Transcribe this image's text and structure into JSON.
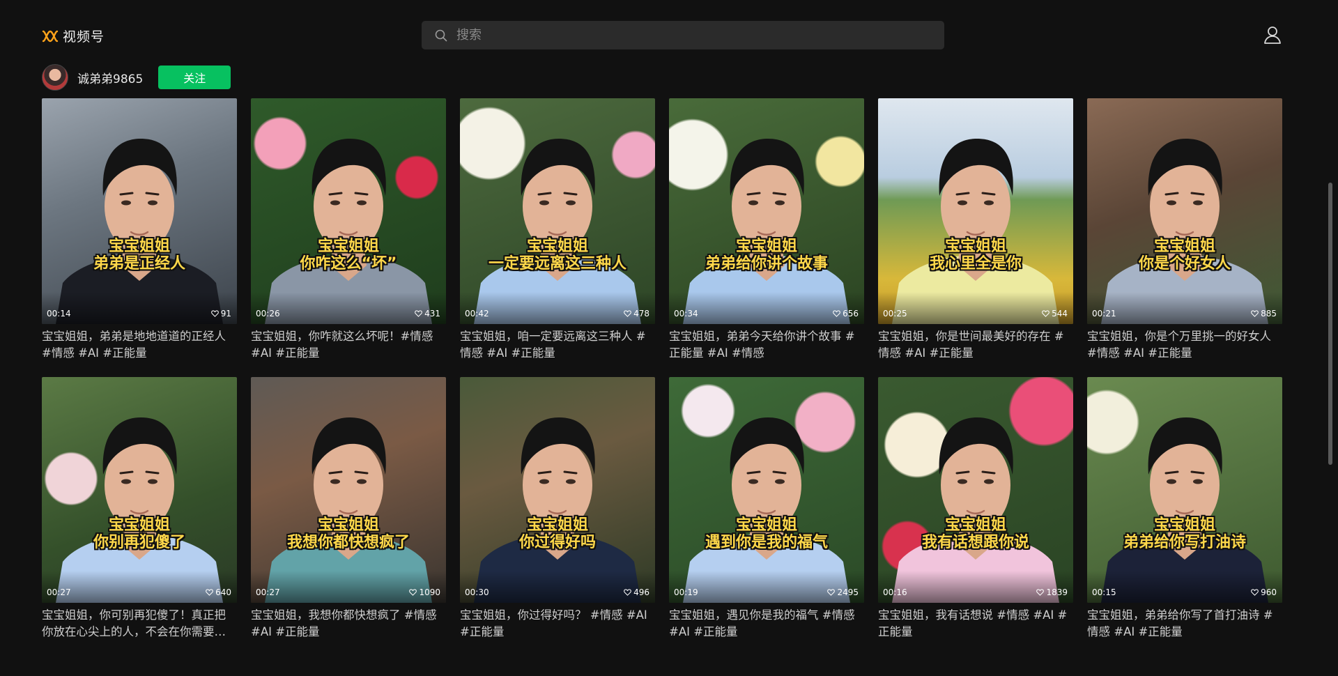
{
  "header": {
    "logo_text": "视频号",
    "search_placeholder": "搜索",
    "accent": "#ffa31a"
  },
  "author": {
    "name": "诚弟弟9865",
    "follow_label": "关注",
    "follow_color": "#07c160"
  },
  "videos": [
    {
      "line1": "宝宝姐姐",
      "line2": "弟弟是正经人",
      "duration": "00:14",
      "likes": "91",
      "desc": "宝宝姐姐，弟弟是地地道道的正经人 #情感 #AI #正能量",
      "bg": "linear-gradient(160deg,#9aa3ad 0%,#6c7680 40%,#3c434b 100%)",
      "shirt": "#1b1d24"
    },
    {
      "line1": "宝宝姐姐",
      "line2": "你咋这么“坏”",
      "duration": "00:26",
      "likes": "431",
      "desc": "宝宝姐姐，你咋就这么坏呢！#情感 #AI #正能量",
      "bg": "radial-gradient(circle at 15% 20%,#f3a0b9 0 10%,transparent 11%),radial-gradient(circle at 85% 35%,#d92a4a 0 9%,transparent 10%),linear-gradient(160deg,#2f5a2a 0%,#1f3d1d 100%)",
      "shirt": "#8a96a6"
    },
    {
      "line1": "宝宝姐姐",
      "line2": "一定要远离这三种人",
      "duration": "00:42",
      "likes": "478",
      "desc": "宝宝姐姐，咱一定要远离这三种人 #情感 #AI #正能量",
      "bg": "radial-gradient(circle at 15% 20%,#f4f2e6 0 14%,transparent 15%),radial-gradient(circle at 90% 25%,#f0a9c4 0 9%,transparent 10%),linear-gradient(160deg,#4d6a3e 0%,#2d4526 100%)",
      "shirt": "#a9c8ec"
    },
    {
      "line1": "宝宝姐姐",
      "line2": "弟弟给你讲个故事",
      "duration": "00:34",
      "likes": "656",
      "desc": "宝宝姐姐，弟弟今天给你讲个故事 #正能量 #AI #情感",
      "bg": "radial-gradient(circle at 12% 25%,#f4f4ea 0 14%,transparent 15%),radial-gradient(circle at 88% 28%,#f2e6a0 0 10%,transparent 11%),linear-gradient(160deg,#496b3a 0%,#2b4422 100%)",
      "shirt": "#a9c8ec"
    },
    {
      "line1": "宝宝姐姐",
      "line2": "我心里全是你",
      "duration": "00:25",
      "likes": "544",
      "desc": "宝宝姐姐，你是世间最美好的存在 #情感 #AI #正能量",
      "bg": "linear-gradient(180deg,#dfe7ef 0%,#b9cde0 35%,#6f9a55 45%,#d8b83a 80%,#c79a2a 100%)",
      "shirt": "#eceaa0"
    },
    {
      "line1": "宝宝姐姐",
      "line2": "你是个好女人",
      "duration": "00:21",
      "likes": "885",
      "desc": "宝宝姐姐，你是个万里挑一的好女人 #情感 #AI #正能量",
      "bg": "linear-gradient(160deg,#8a6a55 0%,#5a4536 45%,#3f5a35 100%)",
      "shirt": "#a6b3c6"
    },
    {
      "line1": "宝宝姐姐",
      "line2": "你别再犯傻了",
      "duration": "00:27",
      "likes": "640",
      "desc": "宝宝姐姐，你可别再犯傻了！真正把你放在心尖上的人，不会在你需要的时候消失",
      "bg": "radial-gradient(circle at 15% 45%,#f0d4d8 0 12%,transparent 13%),linear-gradient(160deg,#5b7a45 0%,#34502a 60%,#2a3a26 100%)",
      "shirt": "#b5cff0"
    },
    {
      "line1": "宝宝姐姐",
      "line2": "我想你都快想疯了",
      "duration": "00:27",
      "likes": "1090",
      "desc": "宝宝姐姐，我想你都快想疯了 #情感 #AI #正能量",
      "bg": "linear-gradient(160deg,#5f5a55 0%,#7a5a45 40%,#3a3530 100%)",
      "shirt": "#62a3a8"
    },
    {
      "line1": "宝宝姐姐",
      "line2": "你过得好吗",
      "duration": "00:30",
      "likes": "496",
      "desc": "宝宝姐姐，你过得好吗？ #情感 #AI #正能量",
      "bg": "linear-gradient(160deg,#4a5a3a 0%,#6a5a40 40%,#2e3a26 100%)",
      "shirt": "#1e2a44"
    },
    {
      "line1": "宝宝姐姐",
      "line2": "遇到你是我的福气",
      "duration": "00:19",
      "likes": "2495",
      "desc": "宝宝姐姐，遇见你是我的福气 #情感 #AI #正能量",
      "bg": "radial-gradient(circle at 80% 20%,#f2b0c6 0 12%,transparent 13%),radial-gradient(circle at 20% 15%,#f4e8ee 0 10%,transparent 11%),linear-gradient(160deg,#3e6a38 0%,#2b4a27 100%)",
      "shirt": "#b5cff0"
    },
    {
      "line1": "宝宝姐姐",
      "line2": "我有话想跟你说",
      "duration": "00:16",
      "likes": "1839",
      "desc": "宝宝姐姐，我有话想说 #情感 #AI #正能量",
      "bg": "radial-gradient(circle at 20% 30%,#f6eed8 0 14%,transparent 15%),radial-gradient(circle at 85% 15%,#ea4f78 0 13%,transparent 14%),radial-gradient(circle at 15% 75%,#d8324e 0 10%,transparent 11%),linear-gradient(160deg,#3a5a30 0%,#2a4424 100%)",
      "shirt": "#f1c4dc"
    },
    {
      "line1": "宝宝姐姐",
      "line2": "弟弟给你写打油诗",
      "duration": "00:15",
      "likes": "960",
      "desc": "宝宝姐姐，弟弟给你写了首打油诗 #情感 #AI #正能量",
      "bg": "radial-gradient(circle at 10% 20%,#f2efdc 0 12%,transparent 13%),linear-gradient(160deg,#6a8a50 0%,#3e5a30 100%)",
      "shirt": "#1c2238"
    }
  ]
}
